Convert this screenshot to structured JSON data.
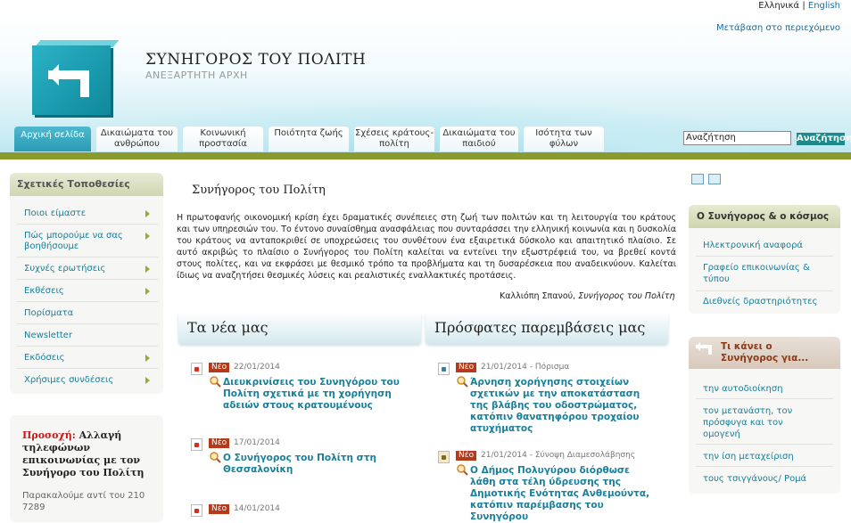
{
  "lang": {
    "greek": "Ελληνικά",
    "sep": "|",
    "english": "English"
  },
  "skip_link": "Μετάβαση στο περιεχόμενο",
  "site": {
    "title": "ΣΥΝΗΓΟΡΟΣ ΤΟΥ ΠΟΛΙΤΗ",
    "subtitle": "ΑΝΕΞΑΡΤΗΤΗ ΑΡΧΗ"
  },
  "nav": [
    {
      "label": "Αρχική σελίδα"
    },
    {
      "label": "Δικαιώματα του ανθρώπου"
    },
    {
      "label": "Κοινωνική προστασία"
    },
    {
      "label": "Ποιότητα ζωής"
    },
    {
      "label": "Σχέσεις κράτους-πολίτη"
    },
    {
      "label": "Δικαιώματα του παιδιού"
    },
    {
      "label": "Ισότητα των φύλων"
    }
  ],
  "search": {
    "value": "Αναζήτηση",
    "button": "Αναζήτηση"
  },
  "left": {
    "header": "Σχετικές Τοποθεσίες",
    "items": [
      {
        "label": "Ποιοι είμαστε"
      },
      {
        "label": "Πώς μπορούμε να σας βοηθήσουμε"
      },
      {
        "label": "Συχνές ερωτήσεις"
      },
      {
        "label": "Εκθέσεις"
      },
      {
        "label": "Πορίσματα"
      },
      {
        "label": "Newsletter"
      },
      {
        "label": "Εκδόσεις"
      },
      {
        "label": "Χρήσιμες συνδέσεις"
      }
    ]
  },
  "notice": {
    "alert": "Προσοχή:",
    "text": "Αλλαγή τηλεφώνων επικοινωνίας με τον Συνήγορο του Πολίτη",
    "sub": "Παρακαλούμε αντί του 210 7289"
  },
  "main": {
    "title": "Συνήγορος του Πολίτη",
    "paragraph": "Η πρωτοφανής οικονομική κρίση έχει δραματικές συνέπειες στη ζωή των πολιτών και τη λειτουργία του κράτους και των υπηρεσιών του. Το έντονο συναίσθημα ανασφάλειας που συνταράσσει την ελληνική κοινωνία και η δυσκολία του κράτους να ανταποκριθεί σε υποχρεώσεις του συνθέτουν ένα εξαιρετικά δύσκολο και απαιτητικό πλαίσιο. Σε αυτό ακριβώς το πλαίσιο ο Συνήγορος του Πολίτη καλείται να εντείνει την εξωστρέφειά του, να βρεθεί κοντά στους πολίτες, και να εκφράσει με θεσμικό τρόπο τα προβλήματα και τη δυσαρέσκεια που αναδεικνύουν. Καλείται ίδιως να αναζητήσει θεσμικές λύσεις και ρεαλιστικές εναλλακτικές προτάσεις.",
    "signature_name": "Καλλιόπη Σπανού,",
    "signature_role": "Συνήγορος του Πολίτη"
  },
  "news": {
    "header": "Τα νέα μας",
    "items": [
      {
        "badge": "Νέο",
        "date": "22/01/2014",
        "title": "Διευκρινίσεις του Συνηγόρου του Πολίτη σχετικά με τη χορήγηση αδειών στους κρατουμένους"
      },
      {
        "badge": "Νέο",
        "date": "17/01/2014",
        "title": "Ο Συνήγορος του Πολίτη στη Θεσσαλονίκη"
      },
      {
        "badge": "Νέο",
        "date": "14/01/2014",
        "title": ""
      }
    ]
  },
  "interventions": {
    "header": "Πρόσφατες παρεμβάσεις μας",
    "items": [
      {
        "badge": "Νέο",
        "date": "21/01/2014 - Πόρισμα",
        "title": "Άρνηση χορήγησης στοιχείων σχετικών με την αποκατάσταση της βλάβης του οδοστρώματος, κατόπιν θανατηφόρου τροχαίου ατυχήματος"
      },
      {
        "badge": "Νέο",
        "date": "21/01/2014 - Σύνοψη Διαμεσολάβησης",
        "title": "Ο Δήμος Πολυγύρου διόρθωσε λάθη στα τέλη ύδρευσης της Δημοτικής Ενότητας Ανθεμούντα, κατόπιν παρέμβασης του Συνηγόρου"
      }
    ]
  },
  "right1": {
    "header": "Ο Συνήγορος & ο κόσμος",
    "items": [
      {
        "label": "Ηλεκτρονική αναφορά"
      },
      {
        "label": "Γραφείο επικοινωνίας & τύπου"
      },
      {
        "label": "Διεθνείς δραστηριότητες"
      }
    ]
  },
  "right2": {
    "header": "Τι κάνει ο Συνήγορος για...",
    "items": [
      {
        "label": "την αυτοδιοίκηση"
      },
      {
        "label": "τον μετανάστη, τον πρόσφυγα και τον ομογενή"
      },
      {
        "label": "την ίση μεταχείριση"
      },
      {
        "label": "τους τσιγγάνους/ Ρομά"
      }
    ]
  },
  "colors": {
    "accent": "#1a7f9a",
    "olive": "#8a9a2c",
    "badge": "#b43a1a",
    "active_tab": "#2a9bb6"
  }
}
